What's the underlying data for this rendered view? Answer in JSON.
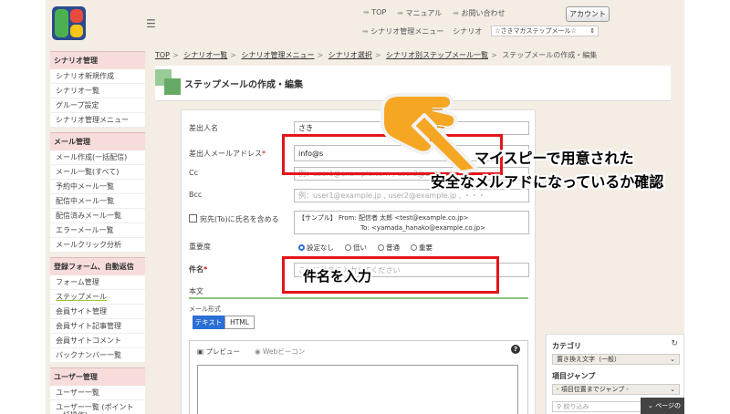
{
  "topnav": {
    "links": [
      "TOP",
      "マニュアル",
      "お問い合わせ"
    ],
    "account_button": "アカウント"
  },
  "subnav": {
    "link": "シナリオ管理メニュー",
    "scenario_label": "シナリオ",
    "scenario_value": "☆さきマガステップメール☆"
  },
  "sidebar": {
    "sections": [
      {
        "title": "シナリオ管理",
        "items": [
          "シナリオ新規作成",
          "シナリオ一覧",
          "グループ設定",
          "シナリオ管理メニュー"
        ]
      },
      {
        "title": "メール管理",
        "items": [
          "メール作成(一括配信)",
          "メール一覧(すべて)",
          "予約中メール一覧",
          "配信中メール一覧",
          "配信済みメール一覧",
          "エラーメール一覧",
          "メールクリック分析"
        ]
      },
      {
        "title": "登録フォーム、自動返信",
        "items": [
          "フォーム管理",
          "ステップメール",
          "会員サイト管理",
          "会員サイト記事管理",
          "会員サイトコメント",
          "バックナンバー一覧"
        ]
      },
      {
        "title": "ユーザー管理",
        "items": [
          "ユーザー一覧",
          "ユーザー一覧\n(ポイント一括操作)"
        ]
      }
    ]
  },
  "breadcrumb": {
    "items": [
      "TOP",
      "シナリオ一覧",
      "シナリオ管理メニュー",
      "シナリオ選択",
      "シナリオ別ステップメール一覧"
    ],
    "current": "ステップメールの作成・編集"
  },
  "page_title": "ステップメールの作成・編集",
  "form": {
    "sender_name_label": "差出人名",
    "sender_name_value": "さき",
    "sender_email_label": "差出人メールアドレス",
    "sender_email_value": "info@s",
    "cc_label": "Cc",
    "cc_placeholder": "例：user1@example.com , user2@example.com",
    "bcc_label": "Bcc",
    "bcc_placeholder": "例：user1@example.jp , user2@example.jp , ・・・",
    "include_name_label": "宛先(To)に氏名を含める",
    "sample_line1": "【サンプル】 From: 配信者 太郎 <test@example.co.jp>",
    "sample_line2": "To: <yamada_hanako@example.co.jp>",
    "priority_label": "重要度",
    "priority_options": [
      "設定なし",
      "低い",
      "普通",
      "重要"
    ],
    "subject_label": "件名",
    "subject_placeholder": "ここに件名を入力してください",
    "body_label": "本文",
    "mail_format_label": "メール形式",
    "format_text": "テキスト",
    "format_html": "HTML",
    "preview_label": "プレビュー",
    "webbeacon_label": "Webビーコン",
    "help_symbol": "?"
  },
  "right_panel": {
    "category_label": "カテゴリ",
    "category_value": "置き換え文字（一般）",
    "jump_label": "項目ジャンプ",
    "jump_value": "- 項目位置までジャンプ -",
    "search_placeholder": "絞り込み"
  },
  "page_jump": "ページの",
  "annotations": {
    "email_note_line1": "マイスピーで用意された",
    "email_note_line2": "安全なメルアドになっているか確認",
    "subject_note": "件名を入力"
  },
  "colors": {
    "accent": "#2a6fd6",
    "annotation_red": "#e4151b",
    "sidebar_head": "#f7dcdc",
    "hand": "#f5a623"
  }
}
